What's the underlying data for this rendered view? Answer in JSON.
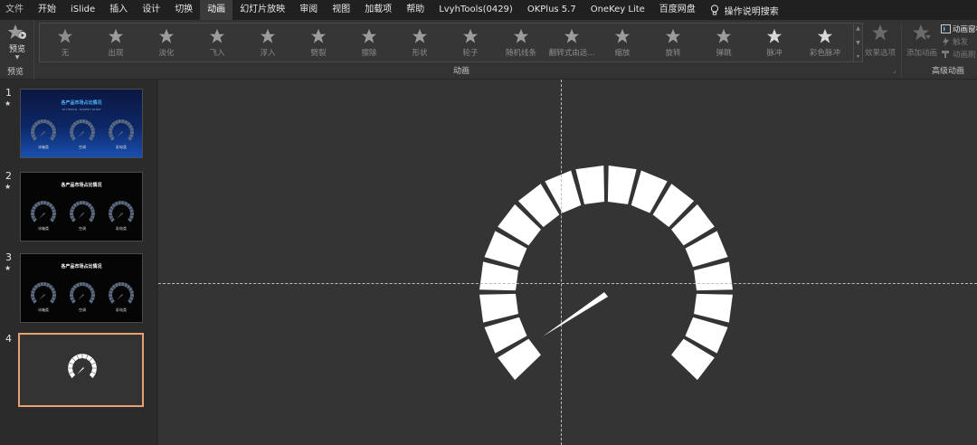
{
  "menubar": {
    "tabs": [
      {
        "label": "文件",
        "name": "file-tab"
      },
      {
        "label": "开始",
        "name": "home-tab"
      },
      {
        "label": "iSlide",
        "name": "islide-tab"
      },
      {
        "label": "插入",
        "name": "insert-tab"
      },
      {
        "label": "设计",
        "name": "design-tab"
      },
      {
        "label": "切换",
        "name": "transitions-tab"
      },
      {
        "label": "动画",
        "name": "animations-tab"
      },
      {
        "label": "幻灯片放映",
        "name": "slideshow-tab"
      },
      {
        "label": "审阅",
        "name": "review-tab"
      },
      {
        "label": "视图",
        "name": "view-tab"
      },
      {
        "label": "加载项",
        "name": "addins-tab"
      },
      {
        "label": "帮助",
        "name": "help-tab"
      },
      {
        "label": "LvyhTools(0429)",
        "name": "lvyhtools-tab"
      },
      {
        "label": "OKPlus 5.7",
        "name": "okplus-tab"
      },
      {
        "label": "OneKey Lite",
        "name": "onekey-lite-tab"
      },
      {
        "label": "百度网盘",
        "name": "baidu-netdisk-tab"
      }
    ],
    "active_tab": "动画",
    "search_label": "操作说明搜索"
  },
  "ribbon": {
    "preview_button": "预览",
    "preview_group": "预览",
    "effects": [
      "无",
      "出现",
      "淡化",
      "飞入",
      "浮入",
      "劈裂",
      "擦除",
      "形状",
      "轮子",
      "随机线条",
      "翻转式由远...",
      "缩放",
      "旋转",
      "弹跳",
      "脉冲",
      "彩色脉冲"
    ],
    "animation_group": "动画",
    "effect_options": "效果选项",
    "add_animation": "添加动画",
    "advanced_items": [
      "动画窗格",
      "触发",
      "动画刷"
    ],
    "advanced_group": "高级动画"
  },
  "slides": [
    {
      "number": "1",
      "star": "★",
      "title": "各产品市场占比情况",
      "subtitle": "PX DESIGN · MARKET SHARE",
      "labels": [
        "冰箱类",
        "空调",
        "彩电类"
      ]
    },
    {
      "number": "2",
      "star": "★",
      "title": "各产品市场占比情况",
      "labels": [
        "冰箱类",
        "空调",
        "彩电类"
      ]
    },
    {
      "number": "3",
      "star": "★",
      "title": "各产品市场占比情况",
      "labels": [
        "冰箱类",
        "空调",
        "彩电类"
      ]
    },
    {
      "number": "4"
    }
  ],
  "colors": {
    "accent_selected": "#e8a072",
    "gauge_fill": "#ffffff",
    "canvas_bg": "#343434",
    "title_blue": "#4fb4ff"
  }
}
